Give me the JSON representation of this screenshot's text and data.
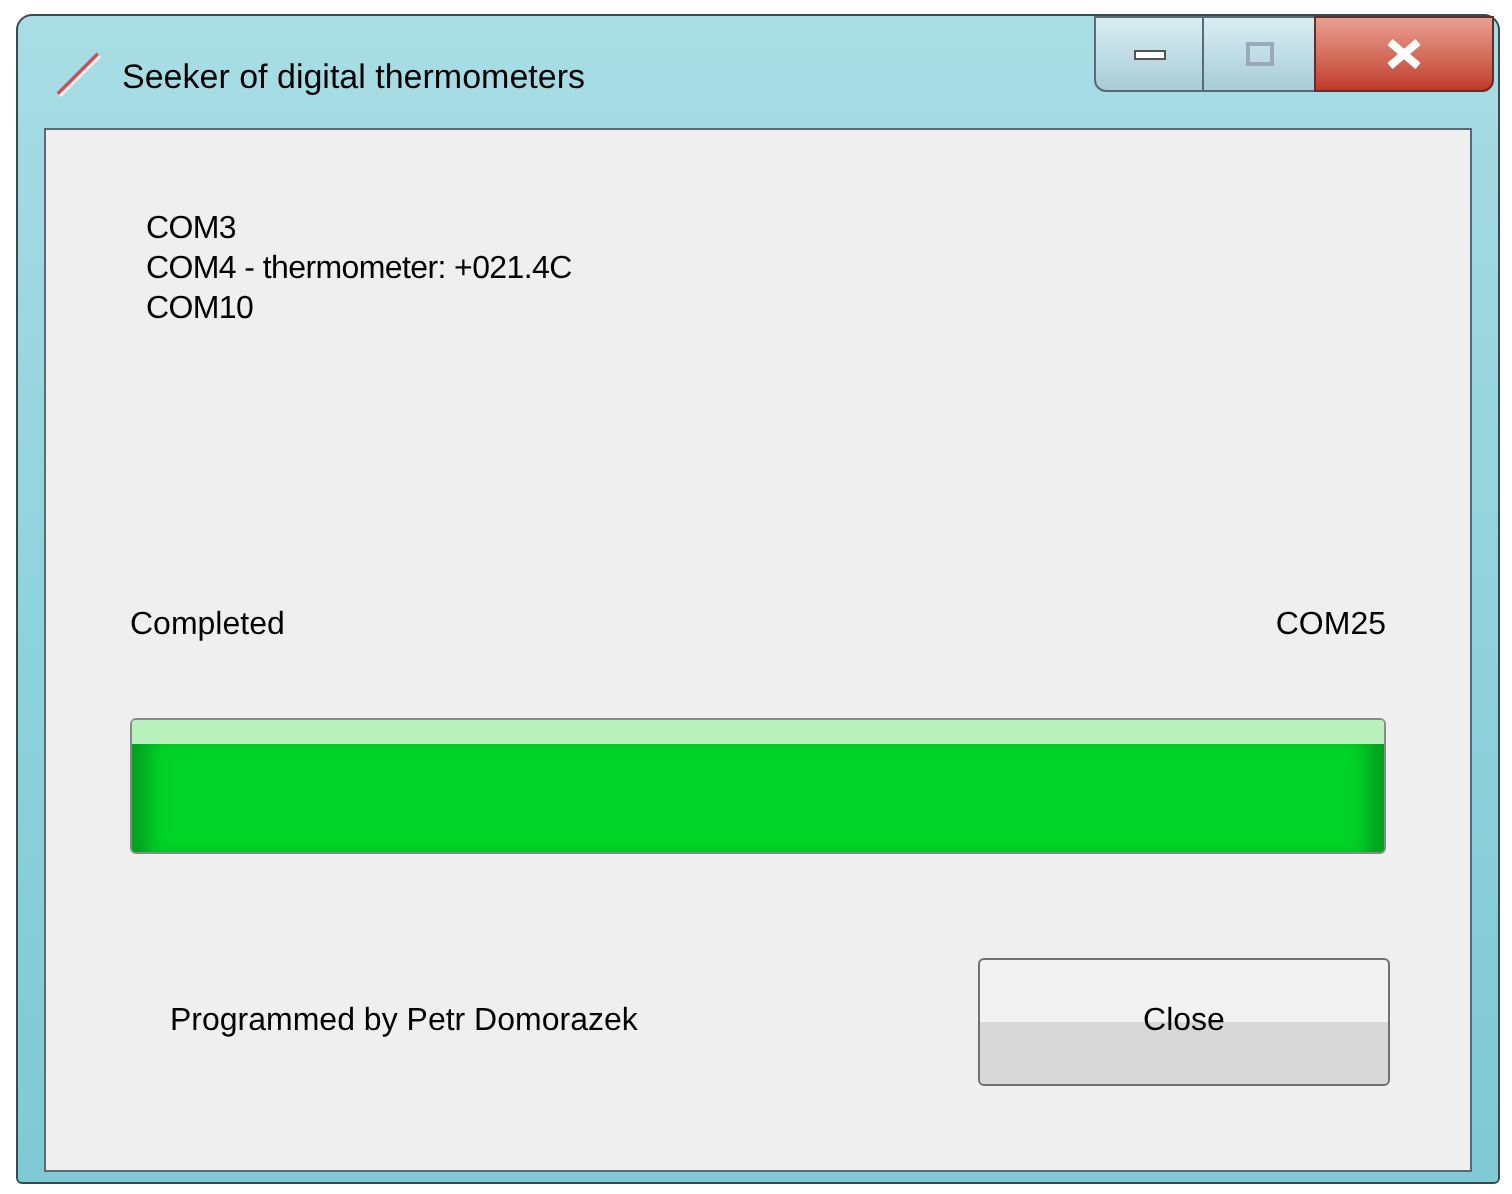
{
  "window": {
    "title": "Seeker of digital thermometers"
  },
  "ports": [
    "COM3",
    "COM4 - thermometer: +021.4C",
    "COM10"
  ],
  "status": {
    "label": "Completed",
    "current_port": "COM25"
  },
  "progress": {
    "level": 1
  },
  "footer": {
    "credit": "Programmed by Petr Domorazek",
    "button": "Close"
  }
}
